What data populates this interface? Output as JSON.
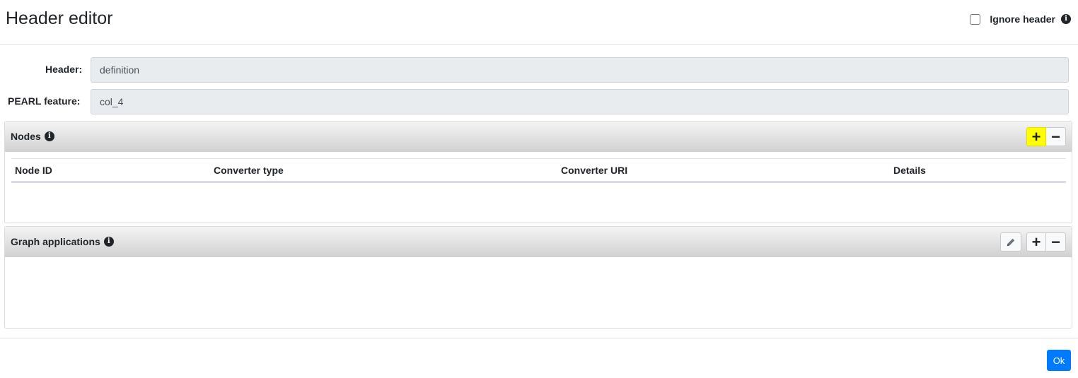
{
  "header": {
    "title": "Header editor",
    "ignore_header_label": "Ignore header",
    "ignore_header_checked": false
  },
  "form": {
    "header_label": "Header:",
    "header_value": "definition",
    "pearl_feature_label": "PEARL feature:",
    "pearl_feature_value": "col_4"
  },
  "nodes_panel": {
    "title": "Nodes",
    "add_label": "+",
    "remove_label": "−",
    "columns": [
      "Node ID",
      "Converter type",
      "Converter URI",
      "Details"
    ],
    "rows": []
  },
  "graph_panel": {
    "title": "Graph applications",
    "add_label": "+",
    "remove_label": "−"
  },
  "footer": {
    "ok_label": "Ok"
  },
  "colors": {
    "primary": "#007bff",
    "highlight": "#ffff00",
    "input_bg": "#e9ecef"
  },
  "icons": {
    "info": "info-icon",
    "edit": "pencil-icon"
  }
}
